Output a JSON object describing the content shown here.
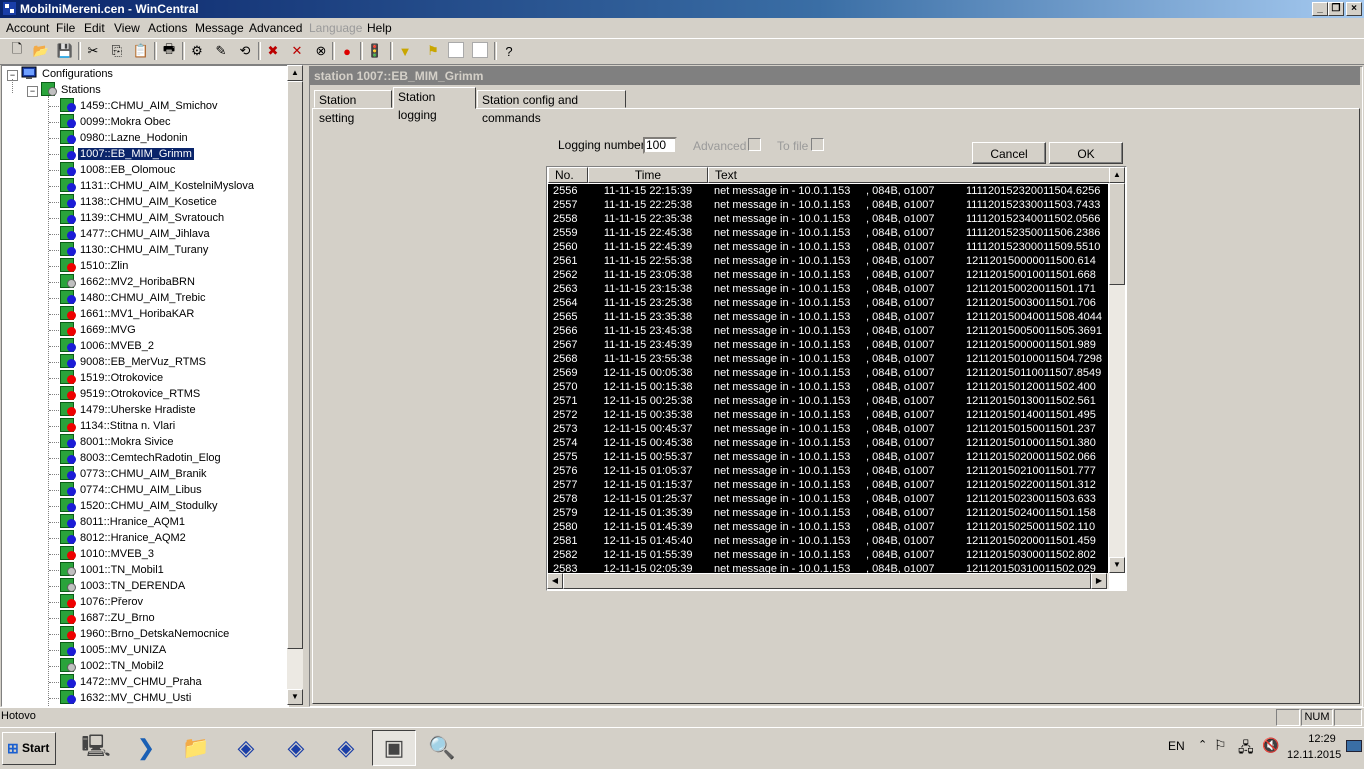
{
  "window": {
    "title": "MobilniMereni.cen - WinCentral",
    "min_label": "_",
    "restore_label": "❐",
    "close_label": "×"
  },
  "menu": [
    {
      "label": "Account",
      "disabled": false
    },
    {
      "label": "File",
      "disabled": false
    },
    {
      "label": "Edit",
      "disabled": false
    },
    {
      "label": "View",
      "disabled": false
    },
    {
      "label": "Actions",
      "disabled": false
    },
    {
      "label": "Message",
      "disabled": false
    },
    {
      "label": "Advanced",
      "disabled": false
    },
    {
      "label": "Language",
      "disabled": true
    },
    {
      "label": "Help",
      "disabled": false
    }
  ],
  "toolbar": [
    {
      "icon": "new-file-icon",
      "glyph": "🗋"
    },
    {
      "icon": "open-folder-icon",
      "glyph": "📂"
    },
    {
      "icon": "save-icon",
      "glyph": "💾"
    },
    {
      "icon": "cut-icon",
      "glyph": "✂"
    },
    {
      "icon": "copy-icon",
      "glyph": "⎘"
    },
    {
      "icon": "paste-icon",
      "glyph": "📋"
    },
    {
      "icon": "print-icon",
      "glyph": "🖶"
    },
    {
      "icon": "station-config-icon",
      "glyph": "⚙"
    },
    {
      "icon": "station-edit-icon",
      "glyph": "✎"
    },
    {
      "icon": "connect-icon",
      "glyph": "⟲"
    },
    {
      "icon": "delete-station-icon",
      "glyph": "✖"
    },
    {
      "icon": "disconnect-icon",
      "glyph": "✕"
    },
    {
      "icon": "disconnect-all-icon",
      "glyph": "⊗"
    },
    {
      "icon": "stop-icon",
      "glyph": "●"
    },
    {
      "icon": "traffic-light-icon",
      "glyph": "🚦"
    },
    {
      "icon": "filter-icon",
      "glyph": "▼"
    },
    {
      "icon": "filter-flag-icon",
      "glyph": "⚑"
    },
    {
      "icon": "blank-icon",
      "glyph": ""
    },
    {
      "icon": "blank-icon-2",
      "glyph": ""
    },
    {
      "icon": "help-icon",
      "glyph": "?"
    }
  ],
  "tree": {
    "root_label": "Configurations",
    "stations_label": "Stations",
    "stations": [
      {
        "label": "1459::CHMU_AIM_Smichov",
        "status": "blue"
      },
      {
        "label": "0099::Mokra Obec",
        "status": "blue"
      },
      {
        "label": "0980::Lazne_Hodonin",
        "status": "blue"
      },
      {
        "label": "1007::EB_MIM_Grimm",
        "status": "blue",
        "selected": true
      },
      {
        "label": "1008::EB_Olomouc",
        "status": "blue"
      },
      {
        "label": "1131::CHMU_AIM_KostelniMyslova",
        "status": "blue"
      },
      {
        "label": "1138::CHMU_AIM_Kosetice",
        "status": "blue"
      },
      {
        "label": "1139::CHMU_AIM_Svratouch",
        "status": "blue"
      },
      {
        "label": "1477::CHMU_AIM_Jihlava",
        "status": "blue"
      },
      {
        "label": "1130::CHMU_AIM_Turany",
        "status": "blue"
      },
      {
        "label": "1510::Zlin",
        "status": "red"
      },
      {
        "label": "1662::MV2_HoribaBRN",
        "status": "gray"
      },
      {
        "label": "1480::CHMU_AIM_Trebic",
        "status": "blue"
      },
      {
        "label": "1661::MV1_HoribaKAR",
        "status": "red"
      },
      {
        "label": "1669::MVG",
        "status": "red"
      },
      {
        "label": "1006::MVEB_2",
        "status": "blue"
      },
      {
        "label": "9008::EB_MerVuz_RTMS",
        "status": "blue"
      },
      {
        "label": "1519::Otrokovice",
        "status": "red"
      },
      {
        "label": "9519::Otrokovice_RTMS",
        "status": "red"
      },
      {
        "label": "1479::Uherske Hradiste",
        "status": "red"
      },
      {
        "label": "1134::Stitna n. Vlari",
        "status": "red"
      },
      {
        "label": "8001::Mokra Sivice",
        "status": "blue"
      },
      {
        "label": "8003::CemtechRadotin_Elog",
        "status": "blue"
      },
      {
        "label": "0773::CHMU_AIM_Branik",
        "status": "blue"
      },
      {
        "label": "0774::CHMU_AIM_Libus",
        "status": "blue"
      },
      {
        "label": "1520::CHMU_AIM_Stodulky",
        "status": "blue"
      },
      {
        "label": "8011::Hranice_AQM1",
        "status": "blue"
      },
      {
        "label": "8012::Hranice_AQM2",
        "status": "blue"
      },
      {
        "label": "1010::MVEB_3",
        "status": "red"
      },
      {
        "label": "1001::TN_Mobil1",
        "status": "gray"
      },
      {
        "label": "1003::TN_DERENDA",
        "status": "gray"
      },
      {
        "label": "1076::Přerov",
        "status": "red"
      },
      {
        "label": "1687::ZU_Brno",
        "status": "red"
      },
      {
        "label": "1960::Brno_DetskaNemocnice",
        "status": "red"
      },
      {
        "label": "1005::MV_UNIZA",
        "status": "blue"
      },
      {
        "label": "1002::TN_Mobil2",
        "status": "gray"
      },
      {
        "label": "1472::MV_CHMU_Praha",
        "status": "blue"
      },
      {
        "label": "1632::MV_CHMU_Usti",
        "status": "blue"
      }
    ]
  },
  "panel": {
    "header": "station 1007::EB_MIM_Grimm",
    "tabs": [
      "Station setting",
      "Station logging",
      "Station config and commands"
    ],
    "active_tab": 1,
    "logging_number_label": "Logging number:",
    "logging_number_value": "100",
    "advanced_label": "Advanced",
    "to_file_label": "To file",
    "cancel_label": "Cancel",
    "ok_label": "OK"
  },
  "log": {
    "columns": [
      "No.",
      "Time",
      "Text"
    ],
    "rows": [
      [
        "2556",
        "11-11-15 22:15:39",
        "net message in  - 10.0.1.153",
        ", 084B, o1007",
        "111120152320011504.6256"
      ],
      [
        "2557",
        "11-11-15 22:25:38",
        "net message in  - 10.0.1.153",
        ", 084B, o1007",
        "111120152330011503.7433"
      ],
      [
        "2558",
        "11-11-15 22:35:38",
        "net message in  - 10.0.1.153",
        ", 084B, o1007",
        "111120152340011502.0566"
      ],
      [
        "2559",
        "11-11-15 22:45:38",
        "net message in  - 10.0.1.153",
        ", 084B, o1007",
        "111120152350011506.2386"
      ],
      [
        "2560",
        "11-11-15 22:45:39",
        "net message in  - 10.0.1.153",
        ", 084B, 01007",
        "111120152300011509.5510"
      ],
      [
        "2561",
        "11-11-15 22:55:38",
        "net message in  - 10.0.1.153",
        ", 084B, o1007",
        "121120150000011500.614"
      ],
      [
        "2562",
        "11-11-15 23:05:38",
        "net message in  - 10.0.1.153",
        ", 084B, o1007",
        "121120150010011501.668"
      ],
      [
        "2563",
        "11-11-15 23:15:38",
        "net message in  - 10.0.1.153",
        ", 084B, o1007",
        "121120150020011501.171"
      ],
      [
        "2564",
        "11-11-15 23:25:38",
        "net message in  - 10.0.1.153",
        ", 084B, o1007",
        "121120150030011501.706"
      ],
      [
        "2565",
        "11-11-15 23:35:38",
        "net message in  - 10.0.1.153",
        ", 084B, o1007",
        "121120150040011508.4044"
      ],
      [
        "2566",
        "11-11-15 23:45:38",
        "net message in  - 10.0.1.153",
        ", 084B, o1007",
        "121120150050011505.3691"
      ],
      [
        "2567",
        "11-11-15 23:45:39",
        "net message in  - 10.0.1.153",
        ", 084B, 01007",
        "121120150000011501.989"
      ],
      [
        "2568",
        "11-11-15 23:55:38",
        "net message in  - 10.0.1.153",
        ", 084B, o1007",
        "121120150100011504.7298"
      ],
      [
        "2569",
        "12-11-15 00:05:38",
        "net message in  - 10.0.1.153",
        ", 084B, o1007",
        "121120150110011507.8549"
      ],
      [
        "2570",
        "12-11-15 00:15:38",
        "net message in  - 10.0.1.153",
        ", 084B, o1007",
        "121120150120011502.400"
      ],
      [
        "2571",
        "12-11-15 00:25:38",
        "net message in  - 10.0.1.153",
        ", 084B, o1007",
        "121120150130011502.561"
      ],
      [
        "2572",
        "12-11-15 00:35:38",
        "net message in  - 10.0.1.153",
        ", 084B, o1007",
        "121120150140011501.495"
      ],
      [
        "2573",
        "12-11-15 00:45:37",
        "net message in  - 10.0.1.153",
        ", 084B, o1007",
        "121120150150011501.237"
      ],
      [
        "2574",
        "12-11-15 00:45:38",
        "net message in  - 10.0.1.153",
        ", 084B, 01007",
        "121120150100011501.380"
      ],
      [
        "2575",
        "12-11-15 00:55:37",
        "net message in  - 10.0.1.153",
        ", 084B, o1007",
        "121120150200011502.066"
      ],
      [
        "2576",
        "12-11-15 01:05:37",
        "net message in  - 10.0.1.153",
        ", 084B, o1007",
        "121120150210011501.777"
      ],
      [
        "2577",
        "12-11-15 01:15:37",
        "net message in  - 10.0.1.153",
        ", 084B, o1007",
        "121120150220011501.312"
      ],
      [
        "2578",
        "12-11-15 01:25:37",
        "net message in  - 10.0.1.153",
        ", 084B, o1007",
        "121120150230011503.633"
      ],
      [
        "2579",
        "12-11-15 01:35:39",
        "net message in  - 10.0.1.153",
        ", 084B, o1007",
        "121120150240011501.158"
      ],
      [
        "2580",
        "12-11-15 01:45:39",
        "net message in  - 10.0.1.153",
        ", 084B, o1007",
        "121120150250011502.110"
      ],
      [
        "2581",
        "12-11-15 01:45:40",
        "net message in  - 10.0.1.153",
        ", 084B, 01007",
        "121120150200011501.459"
      ],
      [
        "2582",
        "12-11-15 01:55:39",
        "net message in  - 10.0.1.153",
        ", 084B, o1007",
        "121120150300011502.802"
      ],
      [
        "2583",
        "12-11-15 02:05:39",
        "net message in  - 10.0.1.153",
        ", 084B, o1007",
        "121120150310011502.029"
      ]
    ]
  },
  "statusbar": {
    "text": "Hotovo",
    "num": "NUM"
  },
  "taskbar": {
    "start_label": "Start",
    "lang": "EN",
    "time": "12:29",
    "date": "12.11.2015",
    "apps": [
      {
        "icon": "server-manager-icon",
        "pressed": false
      },
      {
        "icon": "powershell-icon",
        "pressed": false
      },
      {
        "icon": "explorer-icon",
        "pressed": false
      },
      {
        "icon": "wincentral-icon-1",
        "pressed": false
      },
      {
        "icon": "wincentral-icon-2",
        "pressed": false
      },
      {
        "icon": "wincentral-icon-3",
        "pressed": false
      },
      {
        "icon": "wincentral-window-icon",
        "pressed": true
      },
      {
        "icon": "magnifier-icon",
        "pressed": false
      }
    ]
  },
  "colors": {
    "titlebar": "#0a246a",
    "selection": "#0a246a",
    "log_row_bg": "#000000",
    "status_blue": "#1b1bd6",
    "status_red": "#ee0000"
  }
}
